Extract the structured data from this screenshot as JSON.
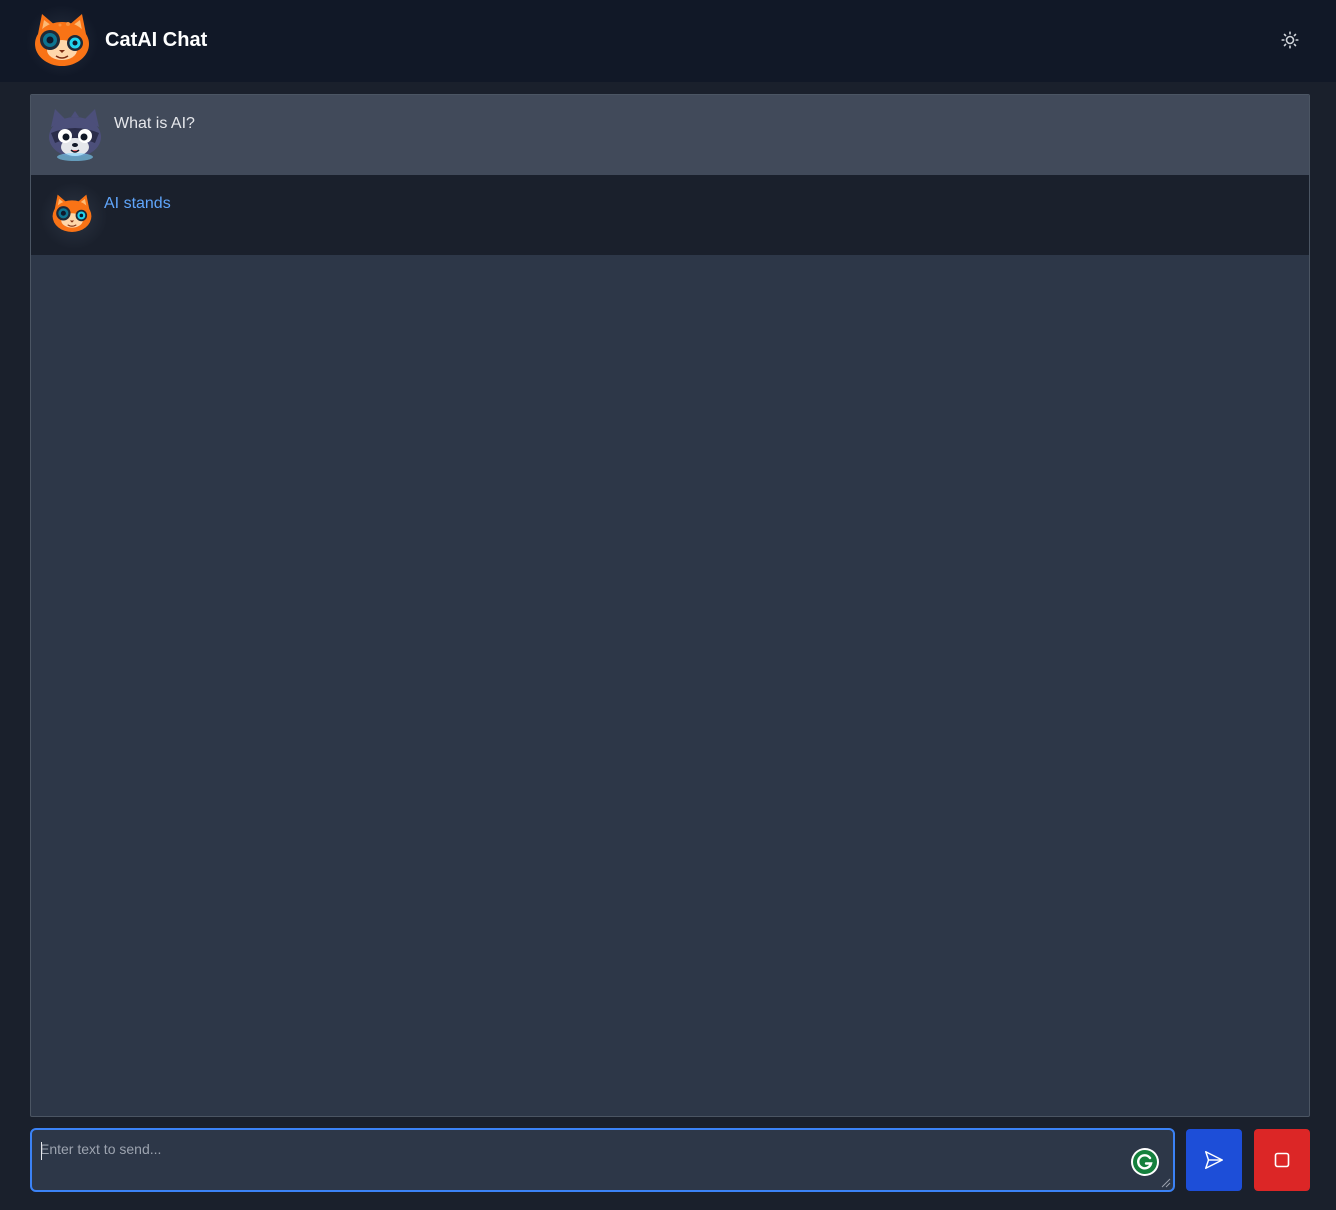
{
  "header": {
    "title": "CatAI Chat",
    "logo_icon": "orange-cat-logo-icon",
    "theme_toggle_icon": "sun-icon"
  },
  "messages": [
    {
      "role": "user",
      "avatar_icon": "raccoon-avatar-icon",
      "text": "What is AI?"
    },
    {
      "role": "assistant",
      "avatar_icon": "orange-cat-avatar-icon",
      "text": "AI stands"
    }
  ],
  "composer": {
    "placeholder": "Enter text to send...",
    "value": "",
    "grammarly_icon": "grammarly-icon",
    "send_icon": "send-icon",
    "stop_icon": "stop-icon"
  },
  "colors": {
    "background": "#1a202c",
    "header": "#111827",
    "chat_panel": "#2d3748",
    "user_message": "#414a5a",
    "assistant_text": "#60a5fa",
    "send_button": "#1d4ed8",
    "stop_button": "#dc2626",
    "input_border": "#3b82f6"
  }
}
